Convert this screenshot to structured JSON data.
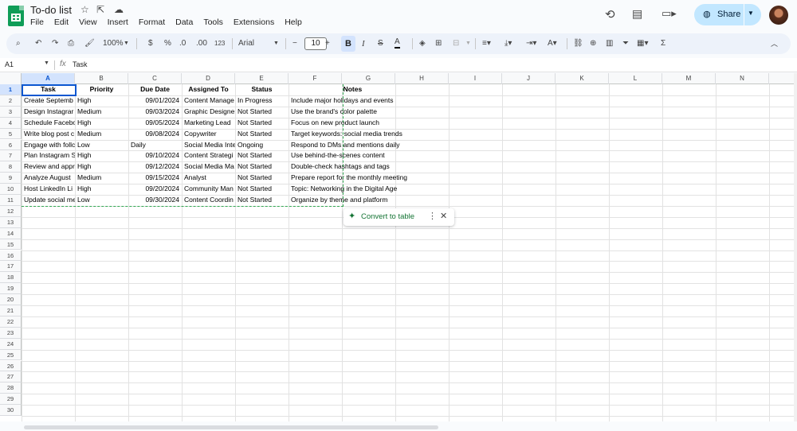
{
  "app": {
    "title": "To-do list"
  },
  "menu": [
    "File",
    "Edit",
    "View",
    "Insert",
    "Format",
    "Data",
    "Tools",
    "Extensions",
    "Help"
  ],
  "header": {
    "share_label": "Share"
  },
  "toolbar": {
    "zoom": "100%",
    "currency": "$",
    "percent": "%",
    "dec_decrease": ".0",
    "dec_increase": ".00",
    "number_format": "123",
    "font": "Arial",
    "font_size": "10",
    "bold": "B",
    "italic": "I",
    "minus": "−",
    "plus": "+"
  },
  "formula_bar": {
    "cell_ref": "A1",
    "fx": "fx",
    "value": "Task"
  },
  "columns": [
    "A",
    "B",
    "C",
    "D",
    "E",
    "F",
    "G",
    "H",
    "I",
    "J",
    "K",
    "L",
    "M",
    "N"
  ],
  "rows": [
    "1",
    "2",
    "3",
    "4",
    "5",
    "6",
    "7",
    "8",
    "9",
    "10",
    "11",
    "12",
    "13",
    "14",
    "15",
    "16",
    "17",
    "18",
    "19",
    "20",
    "21",
    "22",
    "23",
    "24",
    "25",
    "26",
    "27",
    "28",
    "29",
    "30"
  ],
  "table": {
    "headers": [
      "Task",
      "Priority",
      "Due Date",
      "Assigned To",
      "Status",
      "Notes"
    ],
    "rows": [
      [
        "Create Septemb",
        "High",
        "09/01/2024",
        "Content Manage",
        "In Progress",
        "Include major holidays and events"
      ],
      [
        "Design Instagrar",
        "Medium",
        "09/03/2024",
        "Graphic Designe",
        "Not Started",
        "Use the brand's color palette"
      ],
      [
        "Schedule Facebo",
        "High",
        "09/05/2024",
        "Marketing Lead",
        "Not Started",
        "Focus on new product launch"
      ],
      [
        "Write blog post c",
        "Medium",
        "09/08/2024",
        "Copywriter",
        "Not Started",
        "Target keywords: social media trends"
      ],
      [
        "Engage with follc",
        "Low",
        "Daily",
        "Social Media Inte",
        "Ongoing",
        "Respond to DMs and mentions daily"
      ],
      [
        "Plan Instagram S",
        "High",
        "09/10/2024",
        "Content Strategi",
        "Not Started",
        "Use behind-the-scenes content"
      ],
      [
        "Review and appr",
        "High",
        "09/12/2024",
        "Social Media Ma",
        "Not Started",
        "Double-check hashtags and tags"
      ],
      [
        "Analyze August",
        "Medium",
        "09/15/2024",
        "Analyst",
        "Not Started",
        "Prepare report for the monthly meeting"
      ],
      [
        "Host LinkedIn Li",
        "High",
        "09/20/2024",
        "Community Man",
        "Not Started",
        "Topic: Networking in the Digital Age"
      ],
      [
        "Update social me",
        "Low",
        "09/30/2024",
        "Content Coordin",
        "Not Started",
        "Organize by theme and platform"
      ]
    ]
  },
  "chip": {
    "label": "Convert to table",
    "more": "⋮",
    "close": "✕",
    "sparkle": "✦"
  },
  "colors": {
    "accent": "#0b57d0",
    "share_bg": "#c2e7ff",
    "chip_green": "#137333"
  }
}
